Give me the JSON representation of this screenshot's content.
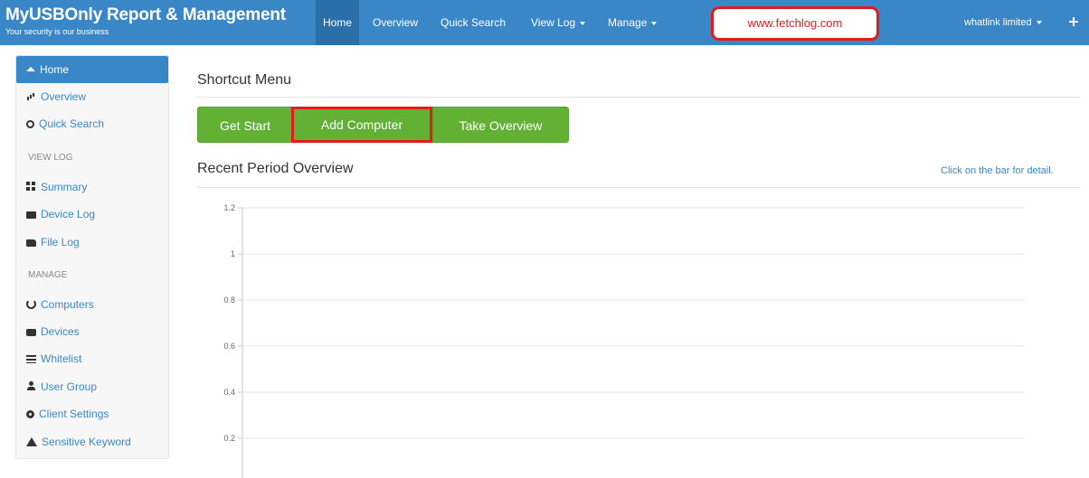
{
  "navbar": {
    "brand_title": "MyUSBOnly Report & Management",
    "brand_subtitle": "Your security is our business",
    "items": [
      {
        "label": "Home",
        "active": true,
        "dropdown": false
      },
      {
        "label": "Overview",
        "active": false,
        "dropdown": false
      },
      {
        "label": "Quick Search",
        "active": false,
        "dropdown": false
      },
      {
        "label": "View Log",
        "active": false,
        "dropdown": true
      },
      {
        "label": "Manage",
        "active": false,
        "dropdown": true
      }
    ],
    "site_label": "www.fetchlog.com",
    "user_label": "whatlink limited",
    "plus_icon": "plus-icon",
    "colors": {
      "bar": "#3a87c8",
      "active": "#2b6fa9",
      "highlight": "#e21c1c"
    }
  },
  "sidebar": {
    "items": [
      {
        "label": "Home",
        "icon": "home-icon",
        "active": true
      },
      {
        "label": "Overview",
        "icon": "bar-chart-icon"
      },
      {
        "label": "Quick Search",
        "icon": "search-icon"
      }
    ],
    "view_log_header": "VIEW LOG",
    "view_log_items": [
      {
        "label": "Summary",
        "icon": "grid-icon"
      },
      {
        "label": "Device Log",
        "icon": "drive-icon"
      },
      {
        "label": "File Log",
        "icon": "folder-open-icon"
      }
    ],
    "manage_header": "MANAGE",
    "manage_items": [
      {
        "label": "Computers",
        "icon": "power-icon"
      },
      {
        "label": "Devices",
        "icon": "camera-icon"
      },
      {
        "label": "Whitelist",
        "icon": "list-icon"
      },
      {
        "label": "User Group",
        "icon": "user-icon"
      },
      {
        "label": "Client Settings",
        "icon": "cog-icon"
      },
      {
        "label": "Sensitive Keyword",
        "icon": "warning-icon"
      }
    ]
  },
  "main": {
    "shortcut_title": "Shortcut Menu",
    "buttons": {
      "get_start": "Get Start",
      "add_computer": "Add Computer",
      "take_overview": "Take Overview"
    },
    "overview_title": "Recent Period Overview",
    "overview_hint": "Click on the bar for detail.",
    "button_color": "#62b034"
  },
  "chart_data": {
    "type": "bar",
    "title": "",
    "xlabel": "",
    "ylabel": "",
    "ylim": [
      0,
      1.2
    ],
    "y_ticks": [
      "1.2",
      "1",
      "0.8",
      "0.6",
      "0.4",
      "0.2"
    ],
    "categories": [],
    "values": [],
    "grid": true
  }
}
